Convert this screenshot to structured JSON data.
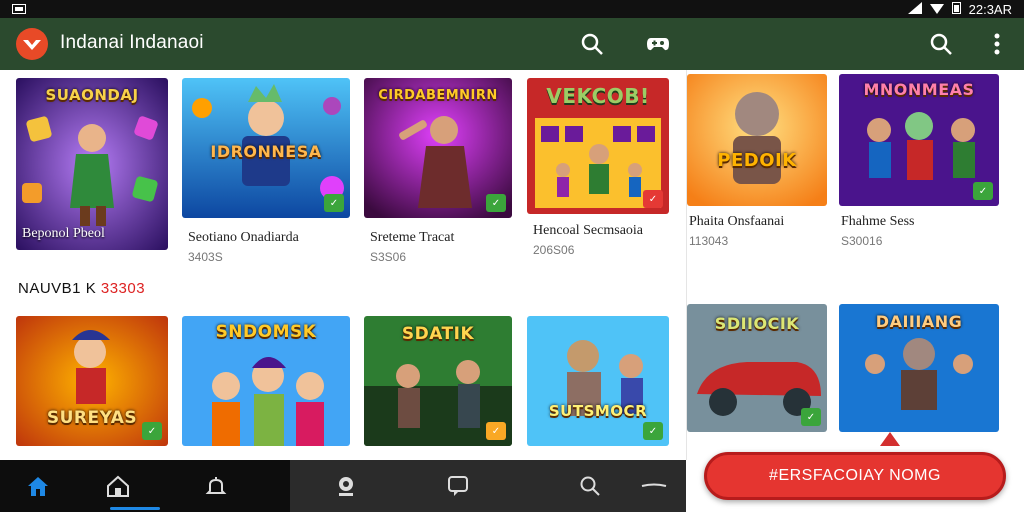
{
  "status_bar": {
    "time": "22:3ΑR"
  },
  "app_bar": {
    "title": "Indanai Indanaoi"
  },
  "colors": {
    "accent": "#2b4a2e",
    "cta": "#e53530",
    "active_nav": "#1e88e5"
  },
  "row1": [
    {
      "thumb_title": "SUAONDAJ",
      "label": "Beponol Pbeol",
      "meta": ""
    },
    {
      "thumb_title": "IDRONNESA",
      "label": "Seotiano Onadiarda",
      "meta": "3403S"
    },
    {
      "thumb_title": "CIRDABEMNIRN",
      "label": "Sreteme Tracat",
      "meta": "S3S06"
    },
    {
      "thumb_title": "VEKCOB!",
      "label": "Hencoal Secmsaoia",
      "meta": "206S06"
    }
  ],
  "section_header": {
    "text": "NAUVB1 K",
    "count": "33303"
  },
  "row2": [
    {
      "thumb_title": "SUREYAS"
    },
    {
      "thumb_title": "SNDOMSK"
    },
    {
      "thumb_title": "SDATIK"
    },
    {
      "thumb_title": "SUTSMOCR"
    }
  ],
  "right_row1": [
    {
      "thumb_title": "PEDOIK",
      "label": "Phaita Onsfaanai",
      "meta": "113043"
    },
    {
      "thumb_title": "MNONMEAS",
      "label": "Fhahme Sess",
      "meta": "S30016"
    }
  ],
  "right_row2": [
    {
      "thumb_title": "SDIIOCIK"
    },
    {
      "thumb_title": "DAIIIANG"
    }
  ],
  "cta": {
    "label": "#ERSFACOIAY NOMG"
  }
}
